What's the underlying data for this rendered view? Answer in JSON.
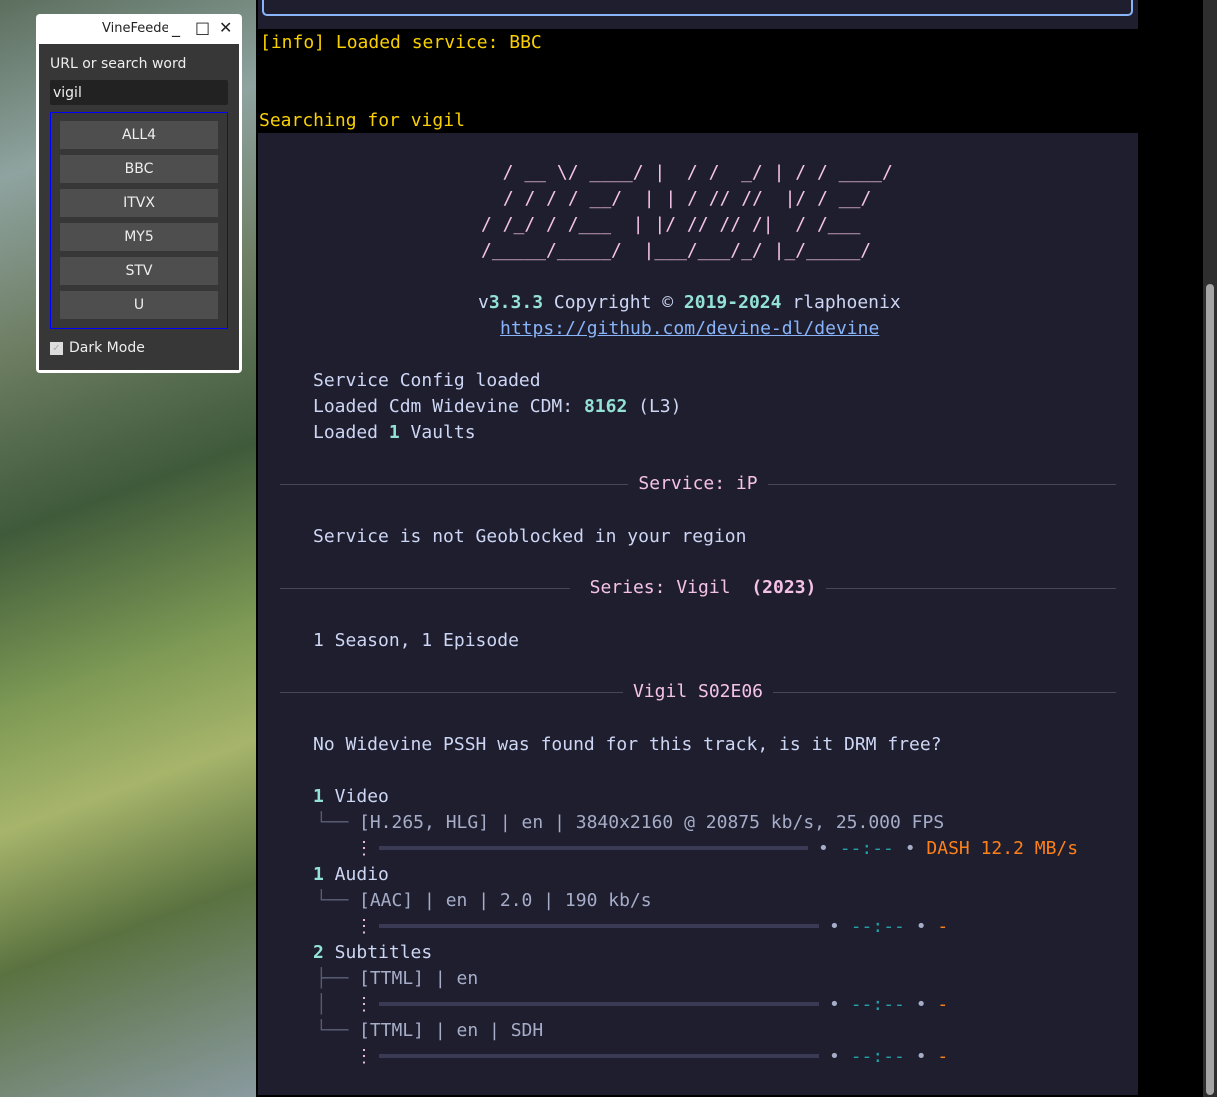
{
  "window": {
    "title": "VineFeeder",
    "minimize": "_",
    "maximize": "□",
    "close": "✕",
    "url_label": "URL or search word",
    "url_value": "vigil",
    "services": [
      "ALL4",
      "BBC",
      "ITVX",
      "MY5",
      "STV",
      "U"
    ],
    "dark_mode_label": "Dark Mode",
    "dark_mode_checked": true
  },
  "log": {
    "info": "[info] Loaded service: BBC",
    "searching": "Searching for vigil"
  },
  "banner": {
    "ascii": [
      "  / __ \\/ ____/ |  / /  _/ | / / ____/",
      " / / / / __/  | | / // //  |/ / __/",
      "/ /_/ / /___  | |/ // // /|  / /___",
      "/_____/_____/  |___/___/_/ |_/_____/"
    ],
    "version_prefix": "v",
    "version": "3.3.3",
    "copyright": " Copyright © ",
    "year_from": "2019",
    "year_sep": "-",
    "year_to": "2024",
    "author": " rlaphoenix",
    "url": "https://github.com/devine-dl/devine"
  },
  "config": {
    "l1": "Service Config loaded",
    "l2a": "Loaded Cdm Widevine CDM: ",
    "cdm": "8162",
    "l2b": " (L3)",
    "l3a": "Loaded ",
    "vaults": "1",
    "l3b": " Vaults"
  },
  "service": {
    "heading": "Service: iP",
    "geo": "Service is not Geoblocked in your region"
  },
  "series": {
    "heading_a": "Series: Vigil ",
    "heading_b": "(2023)",
    "summary": "1 Season, 1 Episode"
  },
  "episode": {
    "heading": "Vigil S02E06",
    "pssh": "No Widevine PSSH was found for this track, is it DRM free?"
  },
  "tracks": {
    "video": {
      "count": "1",
      "label": " Video",
      "detail": "[H.265, HLG] | en | 3840x2160 @ 20875 kb/s, 25.000 FPS",
      "eta": "--:--",
      "status": "DASH 12.2 MB/s",
      "progress": 0
    },
    "audio": {
      "count": "1",
      "label": " Audio",
      "detail": "[AAC] | en | 2.0 | 190 kb/s",
      "eta": "--:--",
      "status": "-",
      "progress": 0
    },
    "subtitles": {
      "count": "2",
      "label": " Subtitles",
      "items": [
        {
          "detail": "[TTML] | en",
          "eta": "--:--",
          "status": "-",
          "progress": 0
        },
        {
          "detail": "[TTML] | en | SDH",
          "eta": "--:--",
          "status": "-",
          "progress": 0
        }
      ]
    }
  },
  "colors": {
    "info": "#f9d000",
    "accent_pink": "#f5c2e7",
    "number_teal": "#94e2d5",
    "status_orange": "#fe8019",
    "link": "#89b4fa",
    "panel_bg": "#1e1e2e"
  }
}
